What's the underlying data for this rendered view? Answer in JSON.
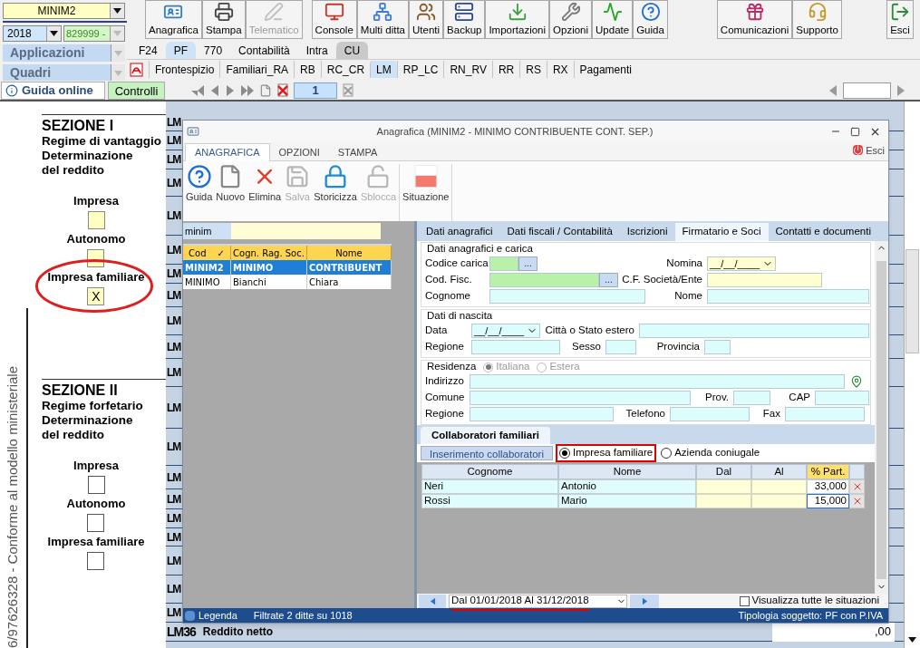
{
  "company_selector": {
    "value": "MINIM2"
  },
  "year_selector": {
    "value": "2018"
  },
  "activity_selector": {
    "value": "829999 -"
  },
  "applications_selector": {
    "label": "Applicazioni"
  },
  "forms_selector": {
    "label": "Quadri"
  },
  "toolbar": [
    [
      {
        "label": "Anagrafica",
        "disabled": false
      },
      {
        "label": "Stampa",
        "disabled": false
      },
      {
        "label": "Telematico",
        "disabled": true
      }
    ],
    [
      {
        "label": "Console",
        "disabled": false
      },
      {
        "label": "Multi ditta",
        "disabled": false
      },
      {
        "label": "Utenti",
        "disabled": false
      },
      {
        "label": "Backup",
        "disabled": false
      },
      {
        "label": "Importazioni",
        "disabled": false
      },
      {
        "label": "Opzioni",
        "disabled": false
      },
      {
        "label": "Update",
        "disabled": false
      },
      {
        "label": "Guida",
        "disabled": false
      }
    ],
    [
      {
        "label": "Comunicazioni",
        "disabled": false
      },
      {
        "label": "Supporto",
        "disabled": false
      }
    ],
    [
      {
        "label": "Esci",
        "disabled": false
      }
    ]
  ],
  "app_tabs": [
    {
      "label": "F24",
      "selected": false,
      "shaded": false
    },
    {
      "label": "PF",
      "selected": true,
      "shaded": false
    },
    {
      "label": "770",
      "selected": false,
      "shaded": false
    },
    {
      "label": "Contabilità",
      "selected": false,
      "shaded": false
    },
    {
      "label": "Intra",
      "selected": false,
      "shaded": false
    },
    {
      "label": "CU",
      "selected": false,
      "shaded": true
    }
  ],
  "form_tabs": [
    {
      "label": "Frontespizio",
      "selected": false
    },
    {
      "label": "Familiari_RA",
      "selected": false
    },
    {
      "label": "RB",
      "selected": false
    },
    {
      "label": "RC_CR",
      "selected": false
    },
    {
      "label": "LM",
      "selected": true
    },
    {
      "label": "RP_LC",
      "selected": false
    },
    {
      "label": "RN_RV",
      "selected": false
    },
    {
      "label": "RR",
      "selected": false
    },
    {
      "label": "RS",
      "selected": false
    },
    {
      "label": "RX",
      "selected": false
    },
    {
      "label": "Pagamenti",
      "selected": false
    }
  ],
  "nav_bar": {
    "help_button": "Guida online",
    "checks_button": "Controlli",
    "page": "1"
  },
  "form_page": {
    "side_note": "6/97626328 - Conforme al modello ministeriale",
    "sections": [
      {
        "title": "SEZIONE I",
        "lines": [
          "Regime di vantaggio",
          "Determinazione",
          "del reddito"
        ],
        "options": [
          {
            "label": "Impresa",
            "editable": true,
            "highlighted": false
          },
          {
            "label": "Autonomo",
            "editable": true,
            "highlighted": false
          },
          {
            "label": "Impresa familiare",
            "editable": true,
            "highlighted": true,
            "mark": "X"
          }
        ]
      },
      {
        "title": "SEZIONE II",
        "lines": [
          "Regime forfetario",
          "Determinazione",
          "del reddito"
        ],
        "options": [
          {
            "label": "Impresa",
            "editable": false,
            "highlighted": false
          },
          {
            "label": "Autonomo",
            "editable": false,
            "highlighted": false
          },
          {
            "label": "Impresa familiare",
            "editable": false,
            "highlighted": false
          }
        ]
      }
    ],
    "row_codes": [
      "LM",
      "LM",
      "LM",
      "LM",
      "LM",
      "LM",
      "LM",
      "LM",
      "LM",
      "LM",
      "LM",
      "LM",
      "LM",
      "LM",
      "LM",
      "LM",
      "LM",
      "LM",
      "LM",
      "LM"
    ],
    "total_row": {
      "code": "LM36",
      "label": "Reddito netto",
      "amount": ",00"
    }
  },
  "dialog": {
    "title": "Anagrafica (MINIM2 - MINIMO CONTRIBUENTE CONT. SEP.)",
    "exit_label": "Esci",
    "ribbon_tabs": [
      {
        "label": "ANAGRAFICA",
        "selected": true
      },
      {
        "label": "OPZIONI",
        "selected": false
      },
      {
        "label": "STAMPA",
        "selected": false
      }
    ],
    "ribbon": [
      [
        {
          "label": "Guida",
          "disabled": false
        },
        {
          "label": "Nuovo",
          "disabled": false
        },
        {
          "label": "Elimina",
          "disabled": false
        },
        {
          "label": "Salva",
          "disabled": true
        },
        {
          "label": "Storicizza",
          "disabled": false
        },
        {
          "label": "Sblocca",
          "disabled": true
        }
      ],
      [
        {
          "label": "Situazione",
          "disabled": false
        }
      ]
    ],
    "search": {
      "value": "minim"
    },
    "company_table": {
      "columns": [
        "Cod",
        "Cogn. Rag. Soc.",
        "Nome"
      ],
      "sort_mark": "✓",
      "rows": [
        {
          "cells": [
            "MINIM2",
            "MINIMO",
            "CONTRIBUENT"
          ],
          "selected": true
        },
        {
          "cells": [
            "MINIMO",
            "Bianchi",
            "Chiara"
          ],
          "selected": false
        }
      ]
    },
    "detail_tabs": [
      {
        "label": "Dati anagrafici",
        "selected": false
      },
      {
        "label": "Dati fiscali / Contabilità",
        "selected": false
      },
      {
        "label": "Iscrizioni",
        "selected": false
      },
      {
        "label": "Firmatario e Soci",
        "selected": true
      },
      {
        "label": "Contatti e documenti",
        "selected": false
      }
    ],
    "groups": [
      {
        "title": "Dati anagrafici e carica",
        "rows": [
          [
            {
              "label": "Codice carica",
              "kind": "lookup",
              "color": "#b9f0aa",
              "button": "..."
            },
            {
              "label": "Nomina",
              "kind": "date",
              "color": "#ffffd2",
              "placeholder": "__/__/____"
            }
          ],
          [
            {
              "label": "Cod. Fisc.",
              "kind": "lookup",
              "color": "#b9f0aa",
              "button": "..."
            },
            {
              "label": "C.F. Società/Ente",
              "kind": "text",
              "color": "#ffffd2"
            }
          ],
          [
            {
              "label": "Cognome",
              "kind": "text",
              "color": "#ddfcfc"
            },
            {
              "label": "Nome",
              "kind": "text",
              "color": "#ddfcfc"
            }
          ]
        ]
      },
      {
        "title": "Dati di nascita",
        "rows": [
          [
            {
              "label": "Data",
              "kind": "date",
              "color": "#ddfcfc",
              "placeholder": "__/__/____"
            },
            {
              "label": "Città o Stato estero",
              "kind": "text",
              "color": "#ddfcfc"
            }
          ],
          [
            {
              "label": "Regione",
              "kind": "text",
              "color": "#ddfcfc"
            },
            {
              "label": "Sesso",
              "kind": "text",
              "color": "#ddfcfc"
            },
            {
              "label": "Provincia",
              "kind": "text",
              "color": "#ddfcfc"
            }
          ]
        ]
      },
      {
        "title": "Residenza",
        "options_disabled": true,
        "options": [
          {
            "label": "Italiana",
            "selected": true
          },
          {
            "label": "Estera",
            "selected": false
          }
        ],
        "rows": [
          [
            {
              "label": "Indirizzo",
              "kind": "address",
              "color": "#ddfcfc"
            }
          ],
          [
            {
              "label": "Comune",
              "kind": "text",
              "color": "#ddfcfc"
            },
            {
              "label": "Prov.",
              "kind": "text",
              "color": "#ddfcfc"
            },
            {
              "label": "CAP",
              "kind": "text",
              "color": "#ddfcfc"
            }
          ],
          [
            {
              "label": "Regione",
              "kind": "text",
              "color": "#ddfcfc"
            },
            {
              "label": "Telefono",
              "kind": "text",
              "color": "#ddfcfc"
            },
            {
              "label": "Fax",
              "kind": "text",
              "color": "#ddfcfc"
            }
          ]
        ]
      }
    ],
    "collaborators": {
      "tab": "Collaboratori familiari",
      "add_button": "Inserimento collaboratori",
      "types": [
        {
          "label": "Impresa familiare",
          "selected": true,
          "highlighted": true
        },
        {
          "label": "Azienda coniugale",
          "selected": false,
          "highlighted": false
        }
      ],
      "columns": [
        "Cognome",
        "Nome",
        "Dal",
        "Al",
        "% Part."
      ],
      "rows": [
        {
          "surname": "Neri",
          "name": "Antonio",
          "share": "33,000",
          "focused": false
        },
        {
          "surname": "Rossi",
          "name": "Mario",
          "share": "15,000",
          "focused": true
        }
      ]
    },
    "period": {
      "value": "Dal 01/01/2018 Al 31/12/2018",
      "highlighted": true
    },
    "show_all": {
      "label": "Visualizza tutte le situazioni",
      "checked": false
    },
    "status_bar": {
      "legend": "Legenda",
      "filter_info": "Filtrate 2 ditte su 1018",
      "subject_type": "Tipologia soggetto: PF con P.IVA"
    }
  }
}
